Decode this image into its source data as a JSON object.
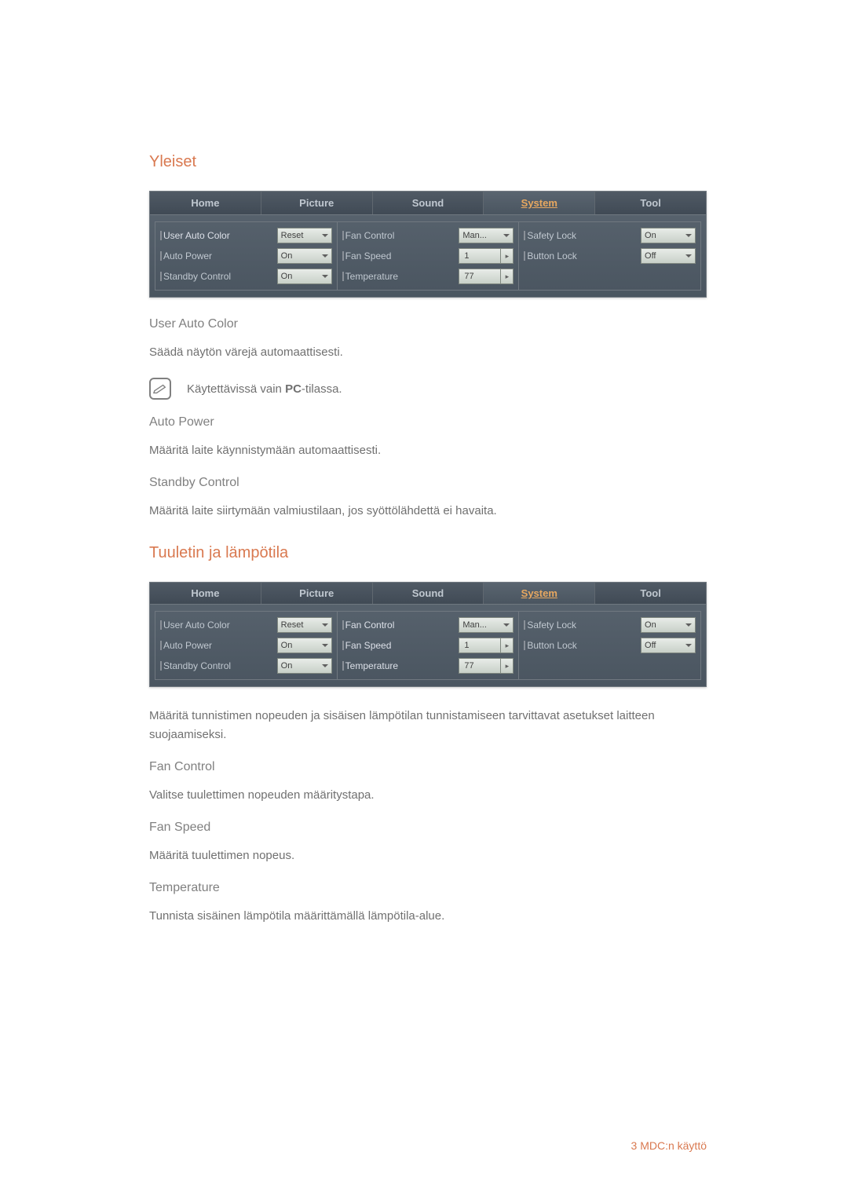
{
  "sections": {
    "general": {
      "heading": "Yleiset",
      "user_auto_color": {
        "label": "User Auto Color",
        "desc": "Säädä näytön värejä automaattisesti."
      },
      "note": {
        "prefix": "Käytettävissä vain ",
        "bold": "PC",
        "suffix": "-tilassa."
      },
      "auto_power": {
        "label": "Auto Power",
        "desc": "Määritä laite käynnistymään automaattisesti."
      },
      "standby_control": {
        "label": "Standby Control",
        "desc": "Määritä laite siirtymään valmiustilaan, jos syöttölähdettä ei havaita."
      }
    },
    "fan_temp": {
      "heading": "Tuuletin ja lämpötila",
      "intro": "Määritä tunnistimen nopeuden ja sisäisen lämpötilan tunnistamiseen tarvittavat asetukset laitteen suojaamiseksi.",
      "fan_control": {
        "label": "Fan Control",
        "desc": "Valitse tuulettimen nopeuden määritystapa."
      },
      "fan_speed": {
        "label": "Fan Speed",
        "desc": "Määritä tuulettimen nopeus."
      },
      "temperature": {
        "label": "Temperature",
        "desc": "Tunnista sisäinen lämpötila määrittämällä lämpötila-alue."
      }
    }
  },
  "panel": {
    "tabs": {
      "home": "Home",
      "picture": "Picture",
      "sound": "Sound",
      "system": "System",
      "tool": "Tool"
    },
    "col1": {
      "user_auto_color": {
        "label": "User Auto Color",
        "value": "Reset"
      },
      "auto_power": {
        "label": "Auto Power",
        "value": "On"
      },
      "standby_control": {
        "label": "Standby Control",
        "value": "On"
      }
    },
    "col2": {
      "fan_control": {
        "label": "Fan Control",
        "value": "Man..."
      },
      "fan_speed": {
        "label": "Fan Speed",
        "value": "1"
      },
      "temperature": {
        "label": "Temperature",
        "value": "77"
      }
    },
    "col3": {
      "safety_lock": {
        "label": "Safety Lock",
        "value": "On"
      },
      "button_lock": {
        "label": "Button Lock",
        "value": "Off"
      }
    }
  },
  "footer": "3 MDC:n käyttö",
  "chart_data": {
    "type": "table",
    "title": "System settings panel",
    "rows": [
      {
        "User Auto Color": "Reset",
        "Fan Control": "Man...",
        "Safety Lock": "On"
      },
      {
        "Auto Power": "On",
        "Fan Speed": "1",
        "Button Lock": "Off"
      },
      {
        "Standby Control": "On",
        "Temperature": "77"
      }
    ]
  }
}
